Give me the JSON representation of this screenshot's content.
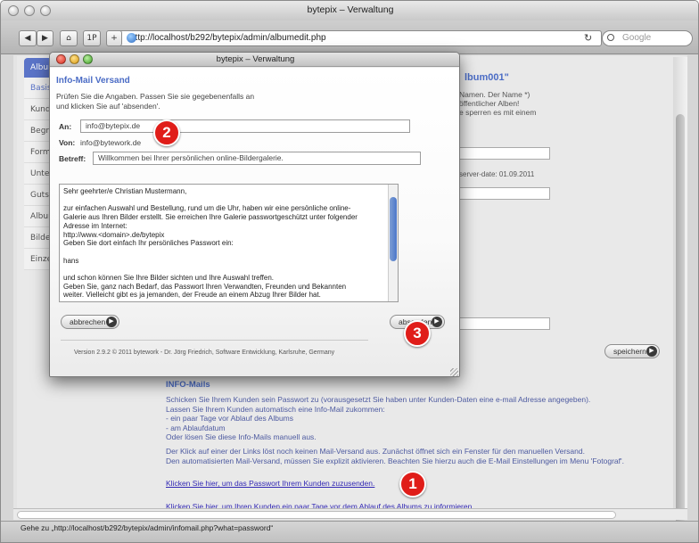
{
  "window": {
    "title": "bytepix – Verwaltung"
  },
  "toolbar": {
    "back": "◀",
    "forward": "▶",
    "home": "⌂",
    "one_p": "1P",
    "add": "+",
    "url": "http://localhost/b292/bytepix/admin/albumedit.php",
    "reload": "↻",
    "search_placeholder": "Google"
  },
  "background_page": {
    "sidebar": [
      {
        "label": "Album"
      },
      {
        "label": "Basis"
      },
      {
        "label": "Kunde"
      },
      {
        "label": "Begrü"
      },
      {
        "label": "Forma"
      },
      {
        "label": "Unter"
      },
      {
        "label": "Gutsc"
      },
      {
        "label": "Album"
      },
      {
        "label": "Bilder"
      },
      {
        "label": "Einzel"
      }
    ],
    "heading_fragment": "lbum001\"",
    "desc_lines": [
      "Namen. Der Name *)",
      "öffentlicher Alben!",
      "e sperren es mit einem"
    ],
    "server_date": "server-date: 01.09.2011",
    "save_label": "speichern",
    "info_mails_title": "INFO-Mails",
    "para1": "Schicken Sie Ihrem Kunden sein Passwort zu (vorausgesetzt Sie haben unter Kunden-Daten eine e-mail Adresse angegeben).\nLassen Sie Ihrem Kunden automatisch eine Info-Mail zukommen:\n- ein paar Tage vor Ablauf des Albums\n- am Ablaufdatum\nOder lösen Sie diese Info-Mails manuell aus.",
    "para2": "Der Klick auf einer der Links löst noch keinen Mail-Versand aus. Zunächst öffnet sich ein Fenster für den manuellen Versand.\nDen automatisierten Mail-Versand, müssen Sie explizit aktivieren. Beachten Sie hierzu auch die E-Mail Einstellungen im Menu 'Fotograf'.",
    "link_password": "Klicken Sie hier, um das Passwort Ihrem Kunden zuzusenden.",
    "link_expiry": "Klicken Sie hier, um Ihren Kunden ein paar Tage vor dem Ablauf des Albums zu informieren."
  },
  "modal": {
    "title": "bytepix – Verwaltung",
    "heading": "Info-Mail Versand",
    "instructions": "Prüfen Sie die Angaben. Passen Sie sie gegebenenfalls an\nund klicken Sie auf 'absenden'.",
    "to_label": "An:",
    "to_value": "info@bytepix.de",
    "from_label": "Von:",
    "from_value": "info@bytework.de",
    "subject_label": "Betreff:",
    "subject_value": "Willkommen bei Ihrer persönlichen online-Bildergalerie.",
    "body": "Sehr geehrter/e Christian Mustermann,\n\nzur einfachen Auswahl und Bestellung, rund um die Uhr, haben wir eine persönliche online-\nGalerie aus Ihren Bilder erstellt. Sie erreichen Ihre Galerie passwortgeschützt unter folgender\nAdresse im Internet:\nhttp://www.<domain>.de/bytepix\nGeben Sie dort einfach Ihr persönliches Passwort ein:\n\nhans\n\nund schon können Sie Ihre Bilder sichten und Ihre Auswahl treffen.\nGeben Sie, ganz nach Bedarf, das Passwort Ihren Verwandten, Freunden und Bekannten\nweiter. Vielleicht gibt es ja jemanden, der Freude an einem Abzug Ihrer Bilder hat.",
    "cancel_label": "abbrechen",
    "send_label": "absenden",
    "footer": "Version 2.9.2 © 2011 bytework - Dr. Jörg Friedrich, Software Entwicklung, Karlsruhe, Germany"
  },
  "badges": {
    "one": "1",
    "two": "2",
    "three": "3"
  },
  "status_bar": "Gehe zu „http://localhost/b292/bytepix/admin/infomail.php?what=password“",
  "colors": {
    "accent_blue": "#4b6cc5",
    "badge_red": "#e01d19",
    "link": "#3228b4"
  }
}
